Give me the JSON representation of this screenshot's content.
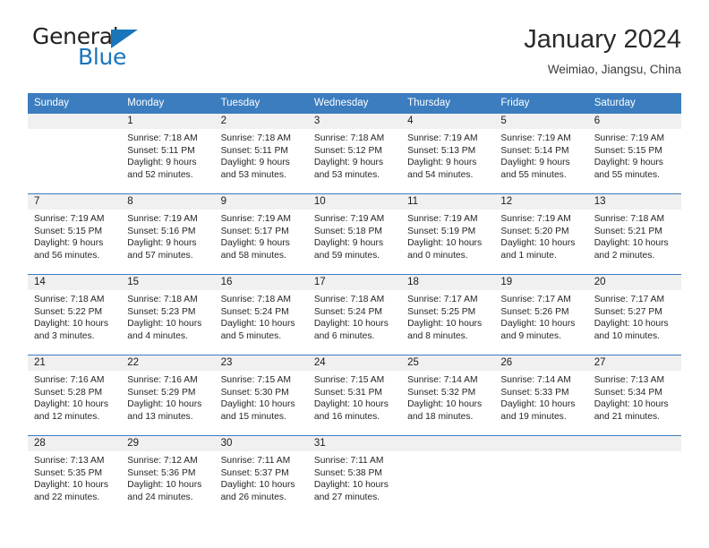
{
  "brand": {
    "word1": "General",
    "word2": "Blue",
    "triangle_color": "#1b75bb",
    "logo_icon": "general-blue-logo-icon"
  },
  "header": {
    "title": "January 2024",
    "location": "Weimiao, Jiangsu, China"
  },
  "theme": {
    "header_blue": "#3b7dbf",
    "daynum_bg": "#f0f0f0",
    "text": "#262626"
  },
  "calendar": {
    "weekday_headers": [
      "Sunday",
      "Monday",
      "Tuesday",
      "Wednesday",
      "Thursday",
      "Friday",
      "Saturday"
    ],
    "weeks": [
      [
        {
          "day": "",
          "sunrise": "",
          "sunset": "",
          "daylight1": "",
          "daylight2": ""
        },
        {
          "day": "1",
          "sunrise": "Sunrise: 7:18 AM",
          "sunset": "Sunset: 5:11 PM",
          "daylight1": "Daylight: 9 hours",
          "daylight2": "and 52 minutes."
        },
        {
          "day": "2",
          "sunrise": "Sunrise: 7:18 AM",
          "sunset": "Sunset: 5:11 PM",
          "daylight1": "Daylight: 9 hours",
          "daylight2": "and 53 minutes."
        },
        {
          "day": "3",
          "sunrise": "Sunrise: 7:18 AM",
          "sunset": "Sunset: 5:12 PM",
          "daylight1": "Daylight: 9 hours",
          "daylight2": "and 53 minutes."
        },
        {
          "day": "4",
          "sunrise": "Sunrise: 7:19 AM",
          "sunset": "Sunset: 5:13 PM",
          "daylight1": "Daylight: 9 hours",
          "daylight2": "and 54 minutes."
        },
        {
          "day": "5",
          "sunrise": "Sunrise: 7:19 AM",
          "sunset": "Sunset: 5:14 PM",
          "daylight1": "Daylight: 9 hours",
          "daylight2": "and 55 minutes."
        },
        {
          "day": "6",
          "sunrise": "Sunrise: 7:19 AM",
          "sunset": "Sunset: 5:15 PM",
          "daylight1": "Daylight: 9 hours",
          "daylight2": "and 55 minutes."
        }
      ],
      [
        {
          "day": "7",
          "sunrise": "Sunrise: 7:19 AM",
          "sunset": "Sunset: 5:15 PM",
          "daylight1": "Daylight: 9 hours",
          "daylight2": "and 56 minutes."
        },
        {
          "day": "8",
          "sunrise": "Sunrise: 7:19 AM",
          "sunset": "Sunset: 5:16 PM",
          "daylight1": "Daylight: 9 hours",
          "daylight2": "and 57 minutes."
        },
        {
          "day": "9",
          "sunrise": "Sunrise: 7:19 AM",
          "sunset": "Sunset: 5:17 PM",
          "daylight1": "Daylight: 9 hours",
          "daylight2": "and 58 minutes."
        },
        {
          "day": "10",
          "sunrise": "Sunrise: 7:19 AM",
          "sunset": "Sunset: 5:18 PM",
          "daylight1": "Daylight: 9 hours",
          "daylight2": "and 59 minutes."
        },
        {
          "day": "11",
          "sunrise": "Sunrise: 7:19 AM",
          "sunset": "Sunset: 5:19 PM",
          "daylight1": "Daylight: 10 hours",
          "daylight2": "and 0 minutes."
        },
        {
          "day": "12",
          "sunrise": "Sunrise: 7:19 AM",
          "sunset": "Sunset: 5:20 PM",
          "daylight1": "Daylight: 10 hours",
          "daylight2": "and 1 minute."
        },
        {
          "day": "13",
          "sunrise": "Sunrise: 7:18 AM",
          "sunset": "Sunset: 5:21 PM",
          "daylight1": "Daylight: 10 hours",
          "daylight2": "and 2 minutes."
        }
      ],
      [
        {
          "day": "14",
          "sunrise": "Sunrise: 7:18 AM",
          "sunset": "Sunset: 5:22 PM",
          "daylight1": "Daylight: 10 hours",
          "daylight2": "and 3 minutes."
        },
        {
          "day": "15",
          "sunrise": "Sunrise: 7:18 AM",
          "sunset": "Sunset: 5:23 PM",
          "daylight1": "Daylight: 10 hours",
          "daylight2": "and 4 minutes."
        },
        {
          "day": "16",
          "sunrise": "Sunrise: 7:18 AM",
          "sunset": "Sunset: 5:24 PM",
          "daylight1": "Daylight: 10 hours",
          "daylight2": "and 5 minutes."
        },
        {
          "day": "17",
          "sunrise": "Sunrise: 7:18 AM",
          "sunset": "Sunset: 5:24 PM",
          "daylight1": "Daylight: 10 hours",
          "daylight2": "and 6 minutes."
        },
        {
          "day": "18",
          "sunrise": "Sunrise: 7:17 AM",
          "sunset": "Sunset: 5:25 PM",
          "daylight1": "Daylight: 10 hours",
          "daylight2": "and 8 minutes."
        },
        {
          "day": "19",
          "sunrise": "Sunrise: 7:17 AM",
          "sunset": "Sunset: 5:26 PM",
          "daylight1": "Daylight: 10 hours",
          "daylight2": "and 9 minutes."
        },
        {
          "day": "20",
          "sunrise": "Sunrise: 7:17 AM",
          "sunset": "Sunset: 5:27 PM",
          "daylight1": "Daylight: 10 hours",
          "daylight2": "and 10 minutes."
        }
      ],
      [
        {
          "day": "21",
          "sunrise": "Sunrise: 7:16 AM",
          "sunset": "Sunset: 5:28 PM",
          "daylight1": "Daylight: 10 hours",
          "daylight2": "and 12 minutes."
        },
        {
          "day": "22",
          "sunrise": "Sunrise: 7:16 AM",
          "sunset": "Sunset: 5:29 PM",
          "daylight1": "Daylight: 10 hours",
          "daylight2": "and 13 minutes."
        },
        {
          "day": "23",
          "sunrise": "Sunrise: 7:15 AM",
          "sunset": "Sunset: 5:30 PM",
          "daylight1": "Daylight: 10 hours",
          "daylight2": "and 15 minutes."
        },
        {
          "day": "24",
          "sunrise": "Sunrise: 7:15 AM",
          "sunset": "Sunset: 5:31 PM",
          "daylight1": "Daylight: 10 hours",
          "daylight2": "and 16 minutes."
        },
        {
          "day": "25",
          "sunrise": "Sunrise: 7:14 AM",
          "sunset": "Sunset: 5:32 PM",
          "daylight1": "Daylight: 10 hours",
          "daylight2": "and 18 minutes."
        },
        {
          "day": "26",
          "sunrise": "Sunrise: 7:14 AM",
          "sunset": "Sunset: 5:33 PM",
          "daylight1": "Daylight: 10 hours",
          "daylight2": "and 19 minutes."
        },
        {
          "day": "27",
          "sunrise": "Sunrise: 7:13 AM",
          "sunset": "Sunset: 5:34 PM",
          "daylight1": "Daylight: 10 hours",
          "daylight2": "and 21 minutes."
        }
      ],
      [
        {
          "day": "28",
          "sunrise": "Sunrise: 7:13 AM",
          "sunset": "Sunset: 5:35 PM",
          "daylight1": "Daylight: 10 hours",
          "daylight2": "and 22 minutes."
        },
        {
          "day": "29",
          "sunrise": "Sunrise: 7:12 AM",
          "sunset": "Sunset: 5:36 PM",
          "daylight1": "Daylight: 10 hours",
          "daylight2": "and 24 minutes."
        },
        {
          "day": "30",
          "sunrise": "Sunrise: 7:11 AM",
          "sunset": "Sunset: 5:37 PM",
          "daylight1": "Daylight: 10 hours",
          "daylight2": "and 26 minutes."
        },
        {
          "day": "31",
          "sunrise": "Sunrise: 7:11 AM",
          "sunset": "Sunset: 5:38 PM",
          "daylight1": "Daylight: 10 hours",
          "daylight2": "and 27 minutes."
        },
        {
          "day": "",
          "sunrise": "",
          "sunset": "",
          "daylight1": "",
          "daylight2": ""
        },
        {
          "day": "",
          "sunrise": "",
          "sunset": "",
          "daylight1": "",
          "daylight2": ""
        },
        {
          "day": "",
          "sunrise": "",
          "sunset": "",
          "daylight1": "",
          "daylight2": ""
        }
      ]
    ]
  }
}
